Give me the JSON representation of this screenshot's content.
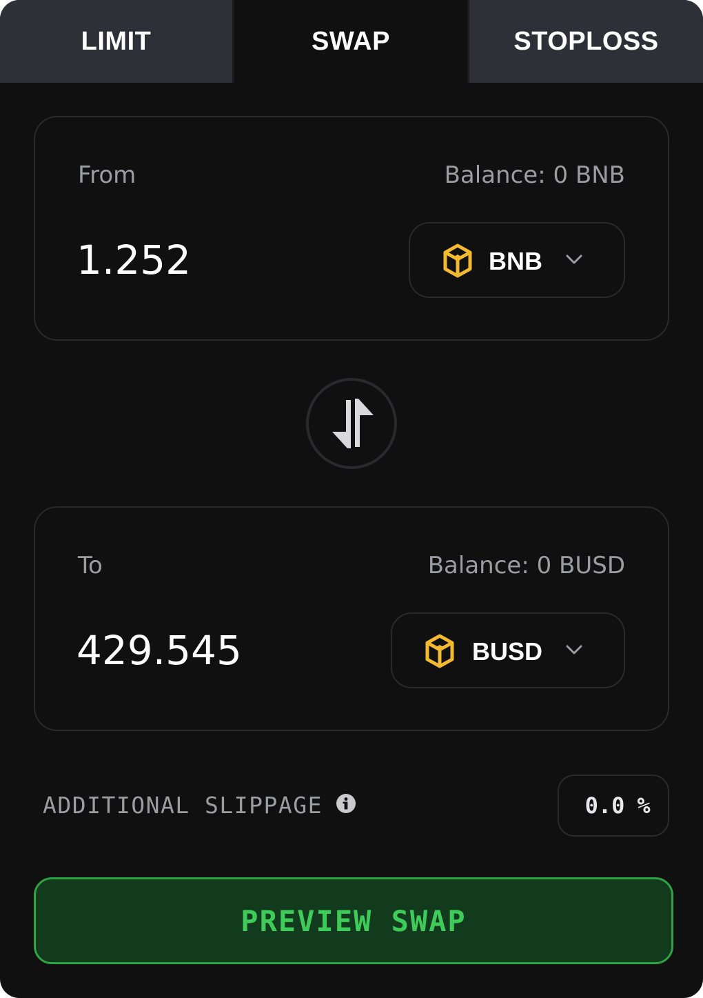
{
  "tabs": [
    {
      "label": "LIMIT",
      "active": false
    },
    {
      "label": "SWAP",
      "active": true
    },
    {
      "label": "STOPLOSS",
      "active": false
    }
  ],
  "from": {
    "label": "From",
    "balance": "Balance: 0 BNB",
    "amount": "1.252",
    "token": "BNB",
    "token_icon": "bnb-icon"
  },
  "to": {
    "label": "To",
    "balance": "Balance: 0 BUSD",
    "amount": "429.545",
    "token": "BUSD",
    "token_icon": "busd-icon"
  },
  "swap_direction_icon": "swap-arrows-icon",
  "slippage": {
    "label": "ADDITIONAL SLIPPAGE",
    "value": "0.0",
    "unit": "%"
  },
  "preview_button": {
    "label": "PREVIEW SWAP"
  },
  "colors": {
    "background": "#101010",
    "inactive_tab": "#2f2f37",
    "border": "#2a2a2e",
    "muted_text": "#9c9ca3",
    "token_gold": "#f3ba2f",
    "accent_green": "#3ecb5a",
    "button_green_bg": "#123a1c"
  }
}
